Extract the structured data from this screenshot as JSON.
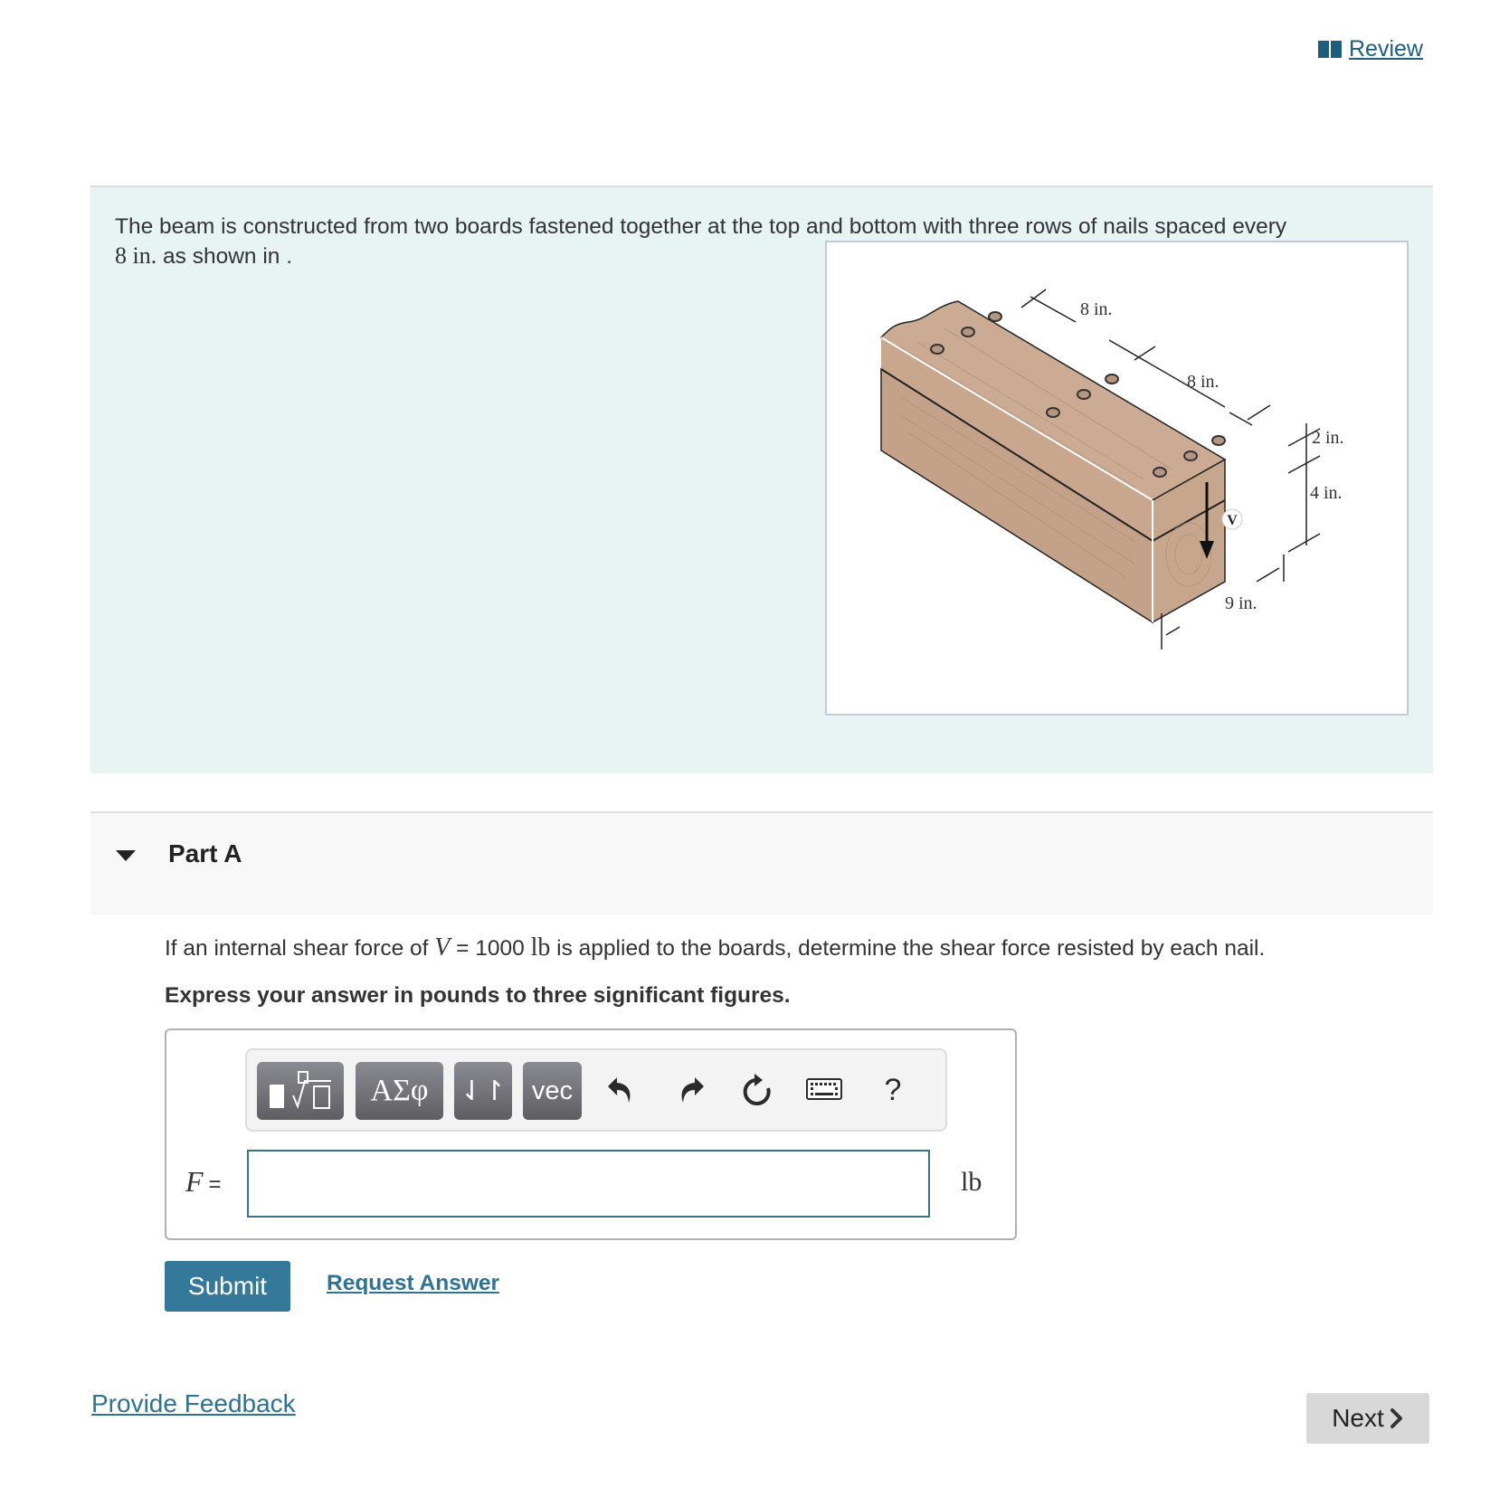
{
  "header": {
    "review_icon": "book-icon",
    "review_label": "Review"
  },
  "intro": {
    "text_part1": "The beam is constructed from two boards fastened together at the top and bottom with three rows of nails spaced every",
    "math_value": "8 in.",
    "text_part2": " as shown in ."
  },
  "figure": {
    "description": "Wooden beam made of two boards nailed together with three rows of nails",
    "labels": {
      "spacing_1": "8 in.",
      "spacing_2": "8 in.",
      "top_thickness": "2 in.",
      "bottom_thickness": "4 in.",
      "width": "9 in.",
      "shear": "V"
    },
    "wood_color": "#c9a98f",
    "wood_dark": "#b08f75"
  },
  "part": {
    "title": "Part A",
    "question_prefix": "If an internal shear force of ",
    "question_var": "V",
    "question_eq": " = 1000 ",
    "question_unit": "lb",
    "question_suffix": " is applied to the boards, determine the shear force resisted by each nail.",
    "instruction": "Express your answer in pounds to three significant figures."
  },
  "toolbar": {
    "buttons": [
      {
        "name": "templates",
        "icon": "template-radical-icon"
      },
      {
        "name": "greek",
        "label": "ΑΣφ"
      },
      {
        "name": "arrows",
        "label": "⇃↾"
      },
      {
        "name": "vector",
        "label": "vec"
      }
    ],
    "icons": [
      "undo-icon",
      "redo-icon",
      "reset-icon",
      "keyboard-icon",
      "help-icon"
    ],
    "help_label": "?"
  },
  "answer": {
    "variable": "F",
    "equals": "=",
    "value": "",
    "placeholder": "",
    "unit": "lb"
  },
  "actions": {
    "submit_label": "Submit",
    "request_label": "Request Answer"
  },
  "footer": {
    "feedback_label": "Provide Feedback",
    "next_label": "Next"
  },
  "colors": {
    "accent": "#35799a",
    "link": "#2e7391",
    "intro_bg": "#e8f4f4",
    "part_bg": "#f8f8f8"
  }
}
